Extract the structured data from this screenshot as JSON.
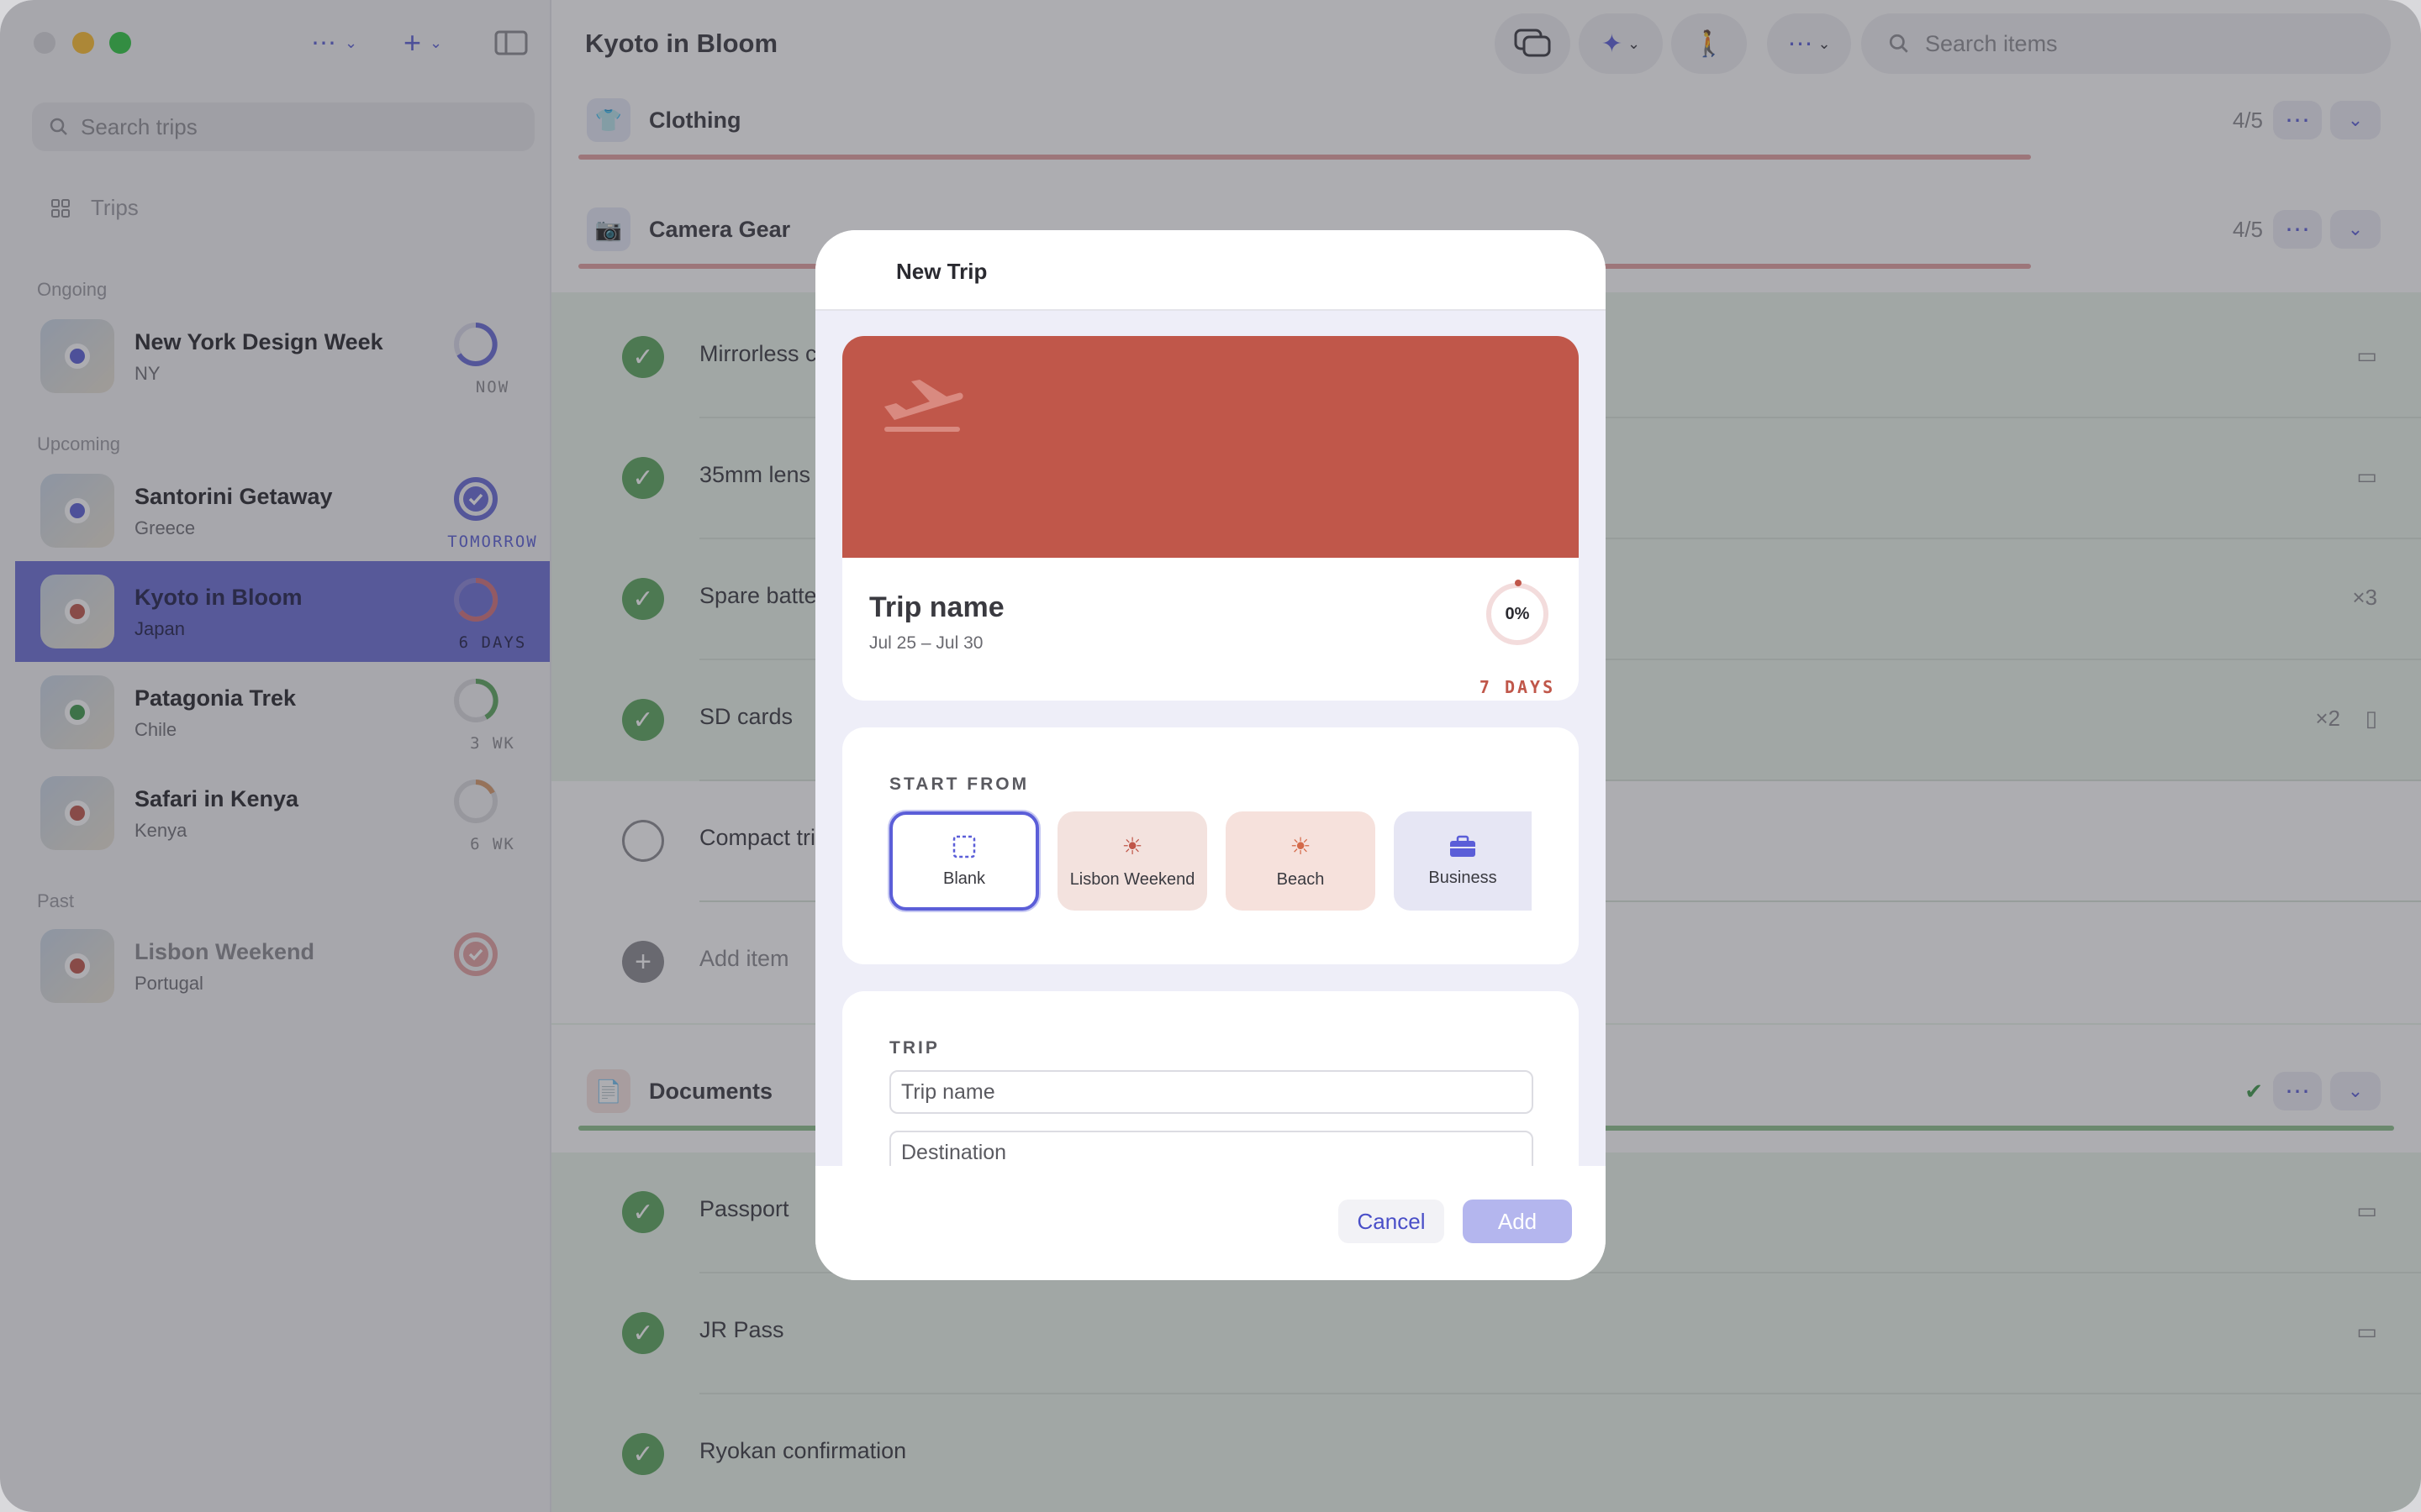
{
  "sidebar": {
    "search_placeholder": "Search trips",
    "nav_trips": "Trips",
    "sections": {
      "ongoing": "Ongoing",
      "upcoming": "Upcoming",
      "past": "Past"
    },
    "trips": [
      {
        "name": "New York Design Week",
        "sub": "NY",
        "when": "NOW",
        "pin_color": "#5a5fd6"
      },
      {
        "name": "Santorini Getaway",
        "sub": "Greece",
        "when": "TOMORROW",
        "pin_color": "#5a5fd6"
      },
      {
        "name": "Kyoto in Bloom",
        "sub": "Japan",
        "when": "6 DAYS",
        "pin_color": "#c0574a"
      },
      {
        "name": "Patagonia Trek",
        "sub": "Chile",
        "when": "3 WK",
        "pin_color": "#3f9a4a"
      },
      {
        "name": "Safari in Kenya",
        "sub": "Kenya",
        "when": "6 WK",
        "pin_color": "#c0574a"
      },
      {
        "name": "Lisbon Weekend",
        "sub": "Portugal",
        "when": "",
        "pin_color": "#c0574a"
      }
    ]
  },
  "main": {
    "title": "Kyoto in Bloom",
    "search_placeholder": "Search items",
    "categories": [
      {
        "name": "Clothing",
        "count": "4/5",
        "progress": 0.8
      },
      {
        "name": "Camera Gear",
        "count": "4/5",
        "progress": 0.8
      },
      {
        "name": "Documents",
        "count": "",
        "progress": 1.0
      }
    ],
    "camera_items": [
      {
        "label": "Mirrorless c",
        "meta": "",
        "done": true
      },
      {
        "label": "35mm lens",
        "meta": "",
        "done": true
      },
      {
        "label": "Spare batter",
        "meta": "×3",
        "done": true
      },
      {
        "label": "SD cards",
        "meta": "×2",
        "done": true
      },
      {
        "label": "Compact tri",
        "meta": "",
        "done": false
      }
    ],
    "add_item": "Add item",
    "document_items": [
      {
        "label": "Passport",
        "done": true
      },
      {
        "label": "JR Pass",
        "done": true
      },
      {
        "label": "Ryokan confirmation",
        "done": true
      }
    ]
  },
  "modal": {
    "title": "New Trip",
    "preview": {
      "name": "Trip name",
      "dates": "Jul 25 – Jul 30",
      "percent": "0%",
      "days": "7 DAYS",
      "accent": "#c0574a"
    },
    "start_from_label": "START FROM",
    "templates": [
      {
        "label": "Blank",
        "icon": "dashed-square-icon",
        "selected": true
      },
      {
        "label": "Lisbon Weekend",
        "icon": "sun-icon",
        "selected": false
      },
      {
        "label": "Beach",
        "icon": "sun-icon",
        "selected": false
      },
      {
        "label": "Business",
        "icon": "briefcase-icon",
        "selected": false
      }
    ],
    "trip_label": "TRIP",
    "trip_name_placeholder": "Trip name",
    "destination_placeholder": "Destination",
    "cancel_label": "Cancel",
    "add_label": "Add"
  }
}
